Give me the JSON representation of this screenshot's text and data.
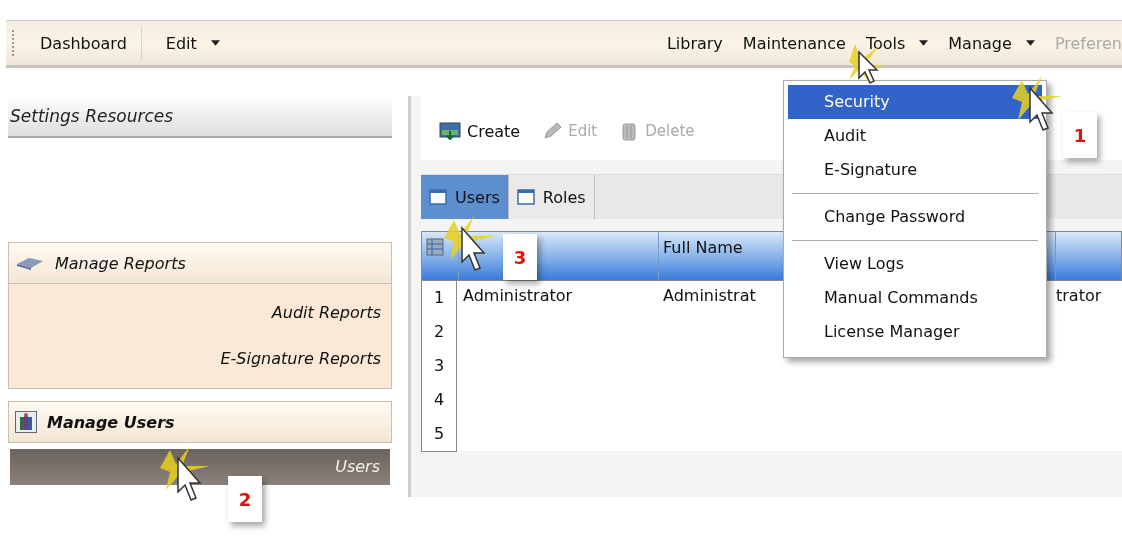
{
  "menubar": {
    "left": [
      {
        "label": "Dashboard",
        "dropdown": false,
        "disabled": false
      },
      {
        "label": "Edit",
        "dropdown": true,
        "disabled": false
      }
    ],
    "right": [
      {
        "label": "Library",
        "dropdown": false,
        "disabled": false
      },
      {
        "label": "Maintenance",
        "dropdown": false,
        "disabled": false
      },
      {
        "label": "Tools",
        "dropdown": true,
        "disabled": false
      },
      {
        "label": "Manage",
        "dropdown": true,
        "disabled": false
      },
      {
        "label": "Preferen",
        "dropdown": false,
        "disabled": true
      }
    ]
  },
  "sidebar": {
    "title": "Settings Resources",
    "groups": [
      {
        "title": "Manage Reports",
        "bold": false,
        "items": [
          {
            "label": "Audit Reports",
            "selected": false
          },
          {
            "label": "E-Signature Reports",
            "selected": false
          }
        ]
      },
      {
        "title": "Manage Users",
        "bold": true,
        "items": [
          {
            "label": "Users",
            "selected": true
          }
        ]
      }
    ]
  },
  "toolbar": [
    {
      "label": "Create",
      "disabled": false
    },
    {
      "label": "Edit",
      "disabled": true
    },
    {
      "label": "Delete",
      "disabled": true
    }
  ],
  "tabs": [
    {
      "label": "Users",
      "selected": true
    },
    {
      "label": "Roles",
      "selected": false
    }
  ],
  "grid": {
    "header": {
      "column_2": "Full Name"
    },
    "rows": [
      {
        "number": "1",
        "column_1": "Administrator",
        "column_2": "Administrat",
        "column_3": "trator"
      },
      {
        "number": "2"
      },
      {
        "number": "3"
      },
      {
        "number": "4"
      },
      {
        "number": "5"
      }
    ]
  },
  "dropdown_menu": {
    "sections": [
      [
        {
          "label": "Security",
          "selected": true
        },
        {
          "label": "Audit",
          "selected": false
        },
        {
          "label": "E-Signature",
          "selected": false
        }
      ],
      [
        {
          "label": "Change Password",
          "selected": false
        }
      ],
      [
        {
          "label": "View Logs",
          "selected": false
        },
        {
          "label": "Manual Commands",
          "selected": false
        },
        {
          "label": "License Manager",
          "selected": false
        }
      ]
    ]
  },
  "callouts": [
    {
      "number": "1"
    },
    {
      "number": "2"
    },
    {
      "number": "3"
    }
  ]
}
